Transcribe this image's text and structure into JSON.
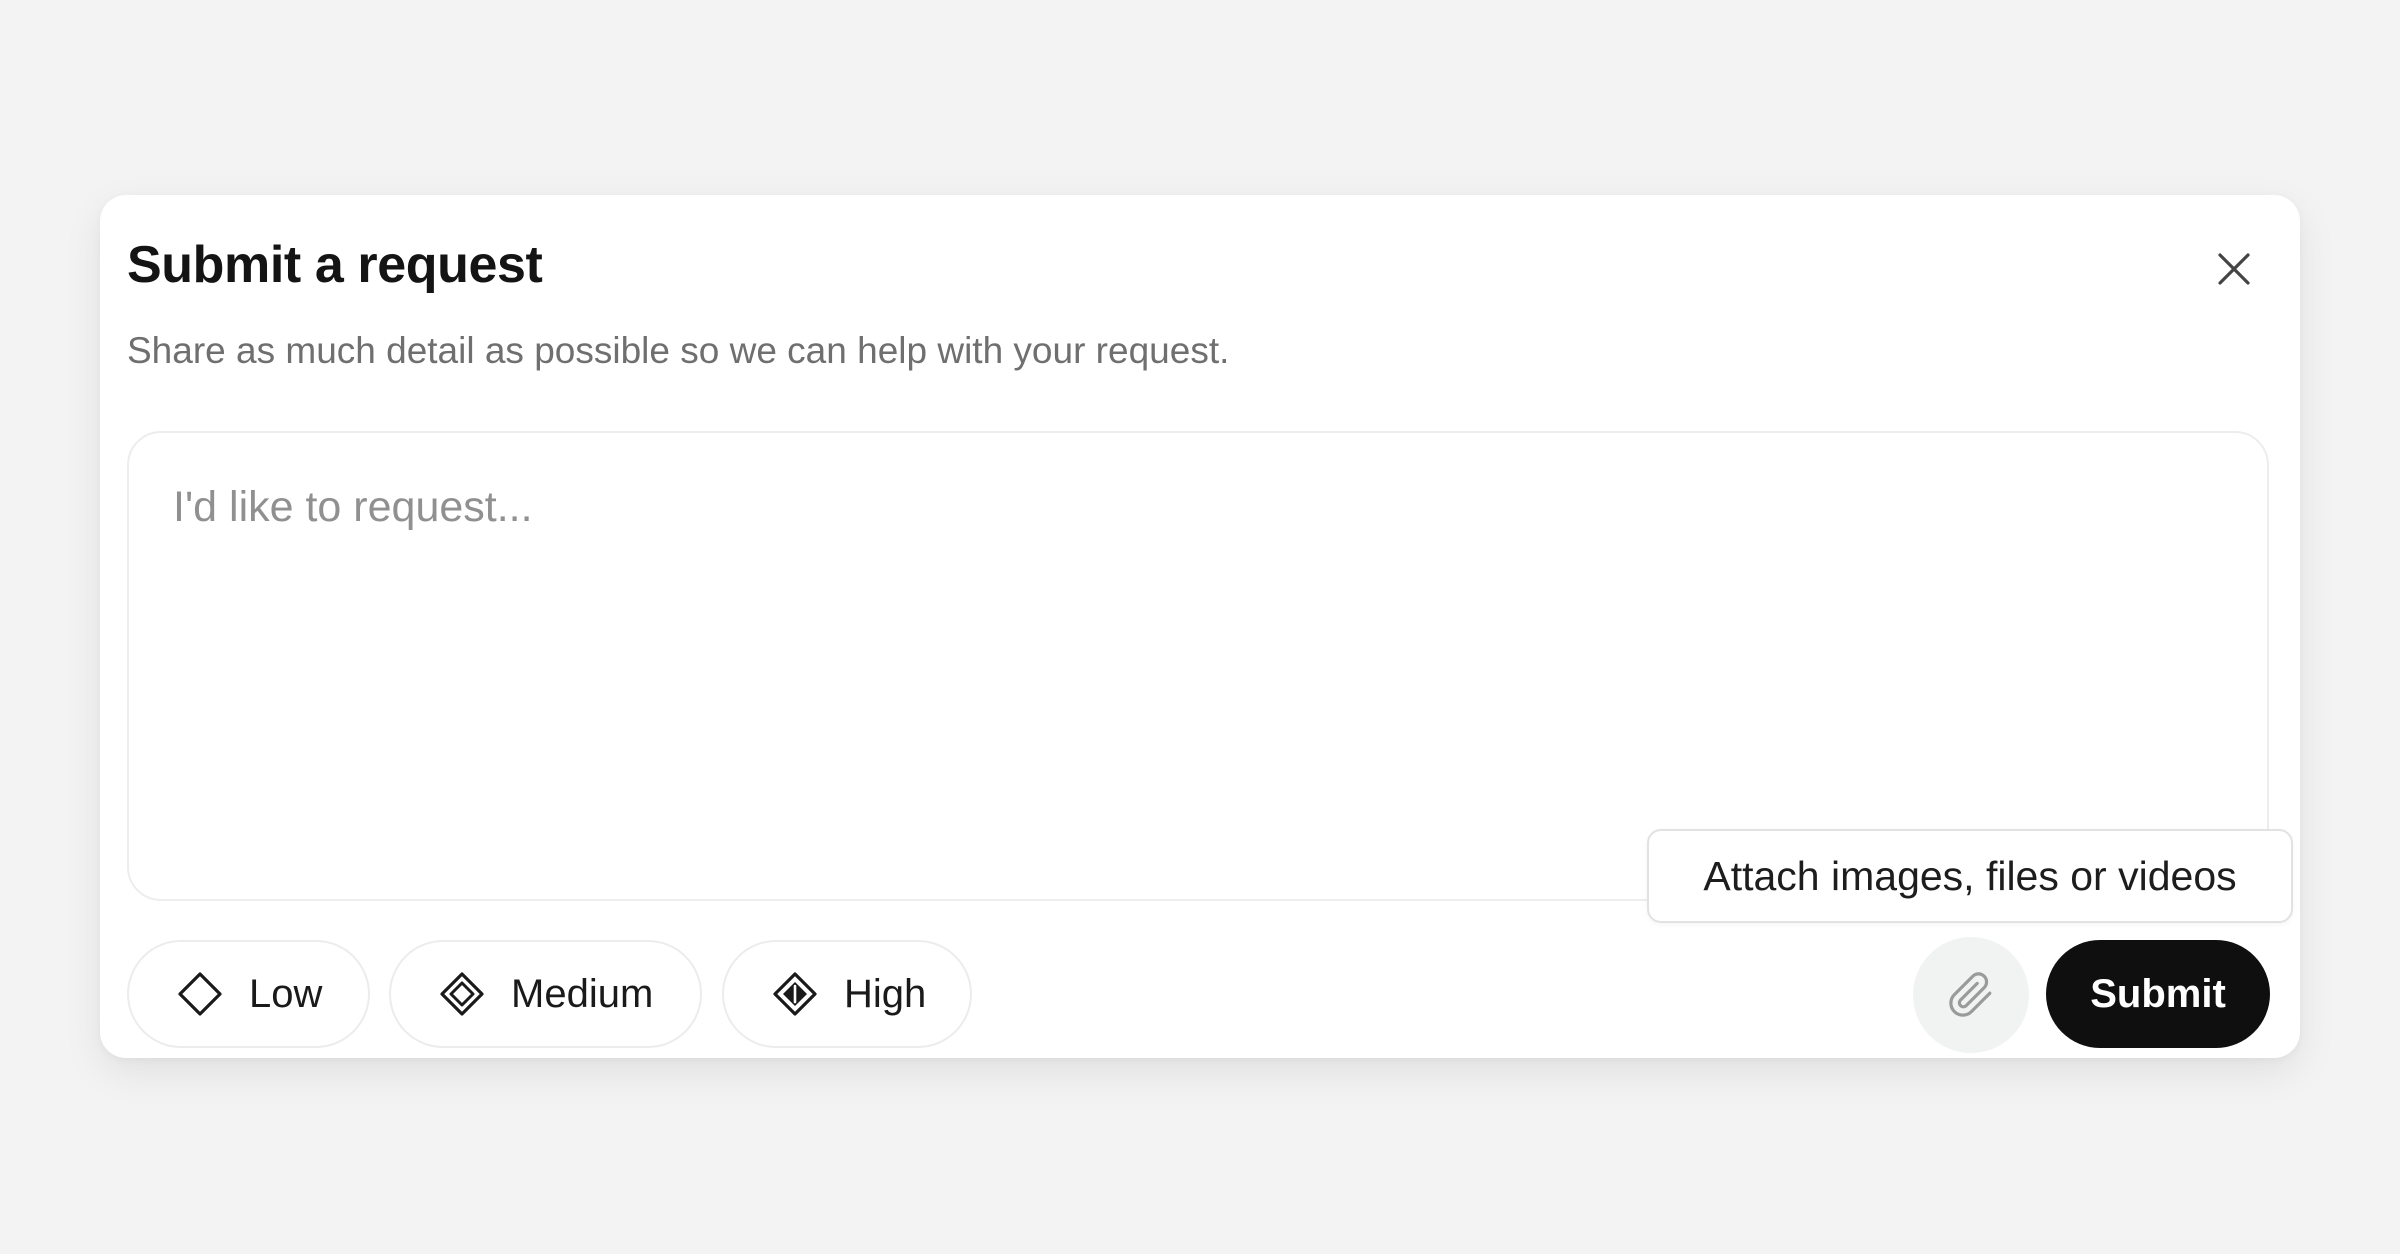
{
  "dialog": {
    "title": "Submit a request",
    "subtitle": "Share as much detail as possible so we can help with your request.",
    "close_icon": "close-icon"
  },
  "request_input": {
    "placeholder": "I'd like to request...",
    "value": ""
  },
  "priority": {
    "options": [
      {
        "label": "Low",
        "icon": "diamond-outline-icon"
      },
      {
        "label": "Medium",
        "icon": "diamond-double-outline-icon"
      },
      {
        "label": "High",
        "icon": "diamond-filled-icon"
      }
    ]
  },
  "attach": {
    "tooltip": "Attach images, files or videos",
    "icon": "paperclip-icon"
  },
  "actions": {
    "submit_label": "Submit"
  },
  "colors": {
    "background": "#f3f3f3",
    "dialog": "#ffffff",
    "submit_bg": "#0f0f0f",
    "submit_text": "#ffffff",
    "subtitle": "#6f6f6f",
    "placeholder": "#909090"
  }
}
